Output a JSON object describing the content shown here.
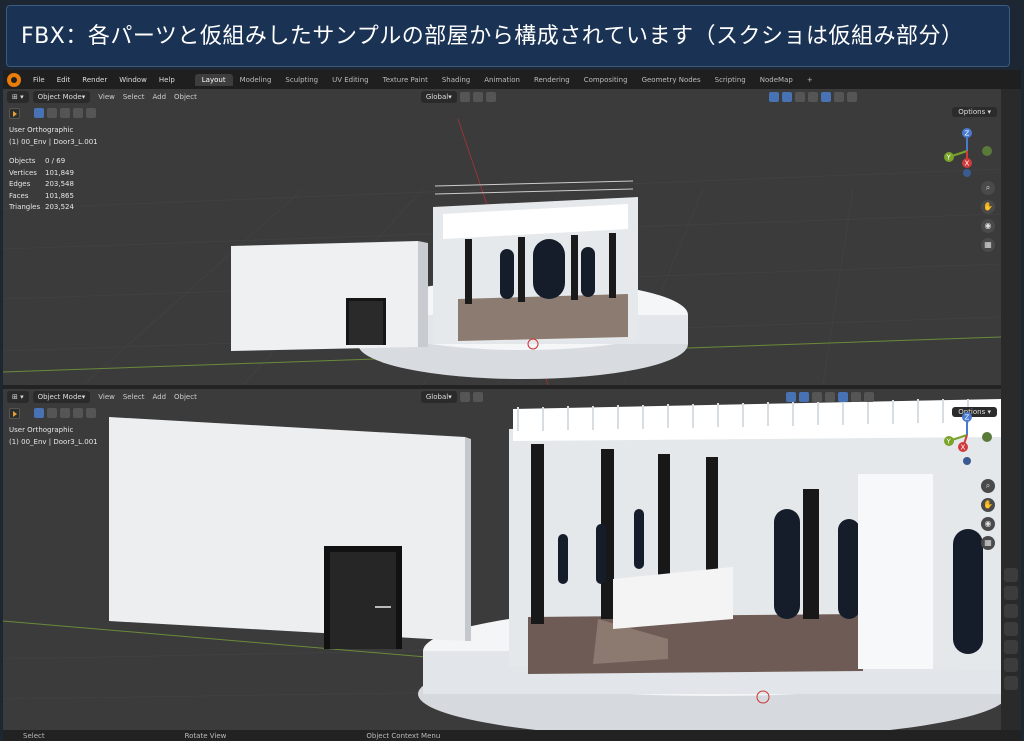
{
  "banner": {
    "title": "FBX：各パーツと仮組みしたサンプルの部屋から構成されています（スクショは仮組み部分）"
  },
  "menu": [
    "File",
    "Edit",
    "Render",
    "Window",
    "Help"
  ],
  "workspaces": [
    {
      "label": "Layout",
      "active": true
    },
    {
      "label": "Modeling"
    },
    {
      "label": "Sculpting"
    },
    {
      "label": "UV Editing"
    },
    {
      "label": "Texture Paint"
    },
    {
      "label": "Shading"
    },
    {
      "label": "Animation"
    },
    {
      "label": "Rendering"
    },
    {
      "label": "Compositing"
    },
    {
      "label": "Geometry Nodes"
    },
    {
      "label": "Scripting"
    },
    {
      "label": "NodeMap"
    }
  ],
  "add_workspace": "+",
  "viewport_header": {
    "mode": "Object Mode",
    "view": "View",
    "select": "Select",
    "add": "Add",
    "object": "Object",
    "orientation": "Global",
    "options": "Options"
  },
  "viewport1": {
    "view_name": "User Orthographic",
    "collection": "(1) 00_Env | Door3_L.001",
    "stats": [
      {
        "label": "Objects",
        "value": "0 / 69"
      },
      {
        "label": "Vertices",
        "value": "101,849"
      },
      {
        "label": "Edges",
        "value": "203,548"
      },
      {
        "label": "Faces",
        "value": "101,865"
      },
      {
        "label": "Triangles",
        "value": "203,524"
      }
    ]
  },
  "viewport2": {
    "view_name": "User Orthographic",
    "collection": "(1) 00_Env | Door3_L.001"
  },
  "gizmo": {
    "z": "Z",
    "y": "Y",
    "x": "X"
  },
  "statusbar": {
    "select": "Select",
    "rotate": "Rotate View",
    "context": "Object Context Menu"
  },
  "colors": {
    "banner_bg": "#1a3254",
    "blender_bg": "#232323",
    "viewport_bg": "#3b3b3b",
    "active_blue": "#4772b3"
  }
}
